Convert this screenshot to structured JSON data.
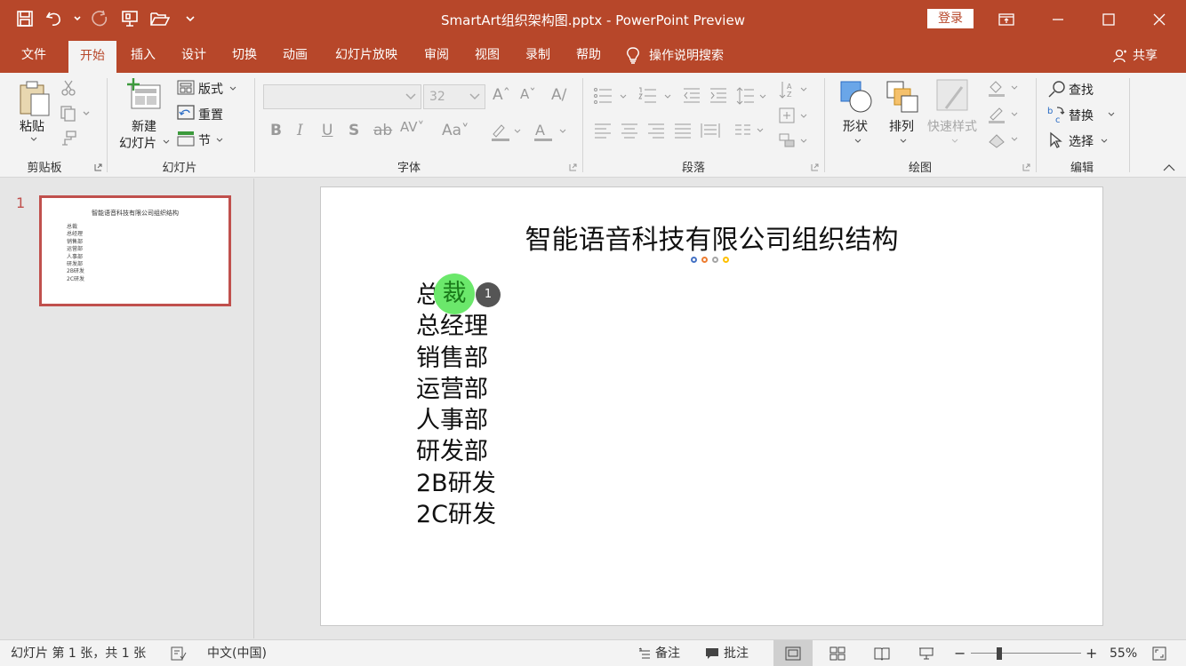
{
  "window": {
    "title": "SmartArt组织架构图.pptx  -  PowerPoint Preview",
    "login_label": "登录"
  },
  "tabs": [
    {
      "label": "文件",
      "active": false
    },
    {
      "label": "开始",
      "active": true
    },
    {
      "label": "插入",
      "active": false
    },
    {
      "label": "设计",
      "active": false
    },
    {
      "label": "切换",
      "active": false
    },
    {
      "label": "动画",
      "active": false
    },
    {
      "label": "幻灯片放映",
      "active": false
    },
    {
      "label": "审阅",
      "active": false
    },
    {
      "label": "视图",
      "active": false
    },
    {
      "label": "录制",
      "active": false
    },
    {
      "label": "帮助",
      "active": false
    }
  ],
  "tell_me": "操作说明搜索",
  "share_label": "共享",
  "ribbon": {
    "clipboard": {
      "group_label": "剪贴板",
      "paste_label": "粘贴"
    },
    "slides": {
      "group_label": "幻灯片",
      "new_slide_line1": "新建",
      "new_slide_line2": "幻灯片",
      "layout_label": "版式",
      "reset_label": "重置",
      "section_label": "节"
    },
    "font": {
      "group_label": "字体",
      "font_name": "",
      "font_size": "32"
    },
    "paragraph": {
      "group_label": "段落"
    },
    "drawing": {
      "group_label": "绘图",
      "shapes_label": "形状",
      "arrange_label": "排列",
      "quick_styles_label": "快速样式"
    },
    "editing": {
      "group_label": "编辑",
      "find_label": "查找",
      "replace_label": "替换",
      "select_label": "选择"
    }
  },
  "thumbnail": {
    "number": "1",
    "title": "智能语音科技有限公司组织结构",
    "items": [
      "总裁",
      "总经理",
      "销售部",
      "运营部",
      "人事部",
      "研发部",
      "2B研发",
      "2C研发"
    ]
  },
  "slide": {
    "title": "智能语音科技有限公司组织结构",
    "items": [
      "总",
      "总经理",
      "销售部",
      "运营部",
      "人事部",
      "研发部",
      "2B研发",
      "2C研发"
    ],
    "highlight_char": "裁",
    "badge": "1",
    "dot_colors": [
      "#4472c4",
      "#ed7d31",
      "#a5a5a5",
      "#ffc000"
    ]
  },
  "status": {
    "slide_info": "幻灯片 第 1 张，共 1 张",
    "language": "中文(中国)",
    "notes_label": "备注",
    "comments_label": "批注",
    "zoom": "55%",
    "zoom_minus": "−",
    "zoom_plus": "+"
  },
  "colors": {
    "accent": "#b7472a",
    "thumb_border": "#c0504d"
  }
}
